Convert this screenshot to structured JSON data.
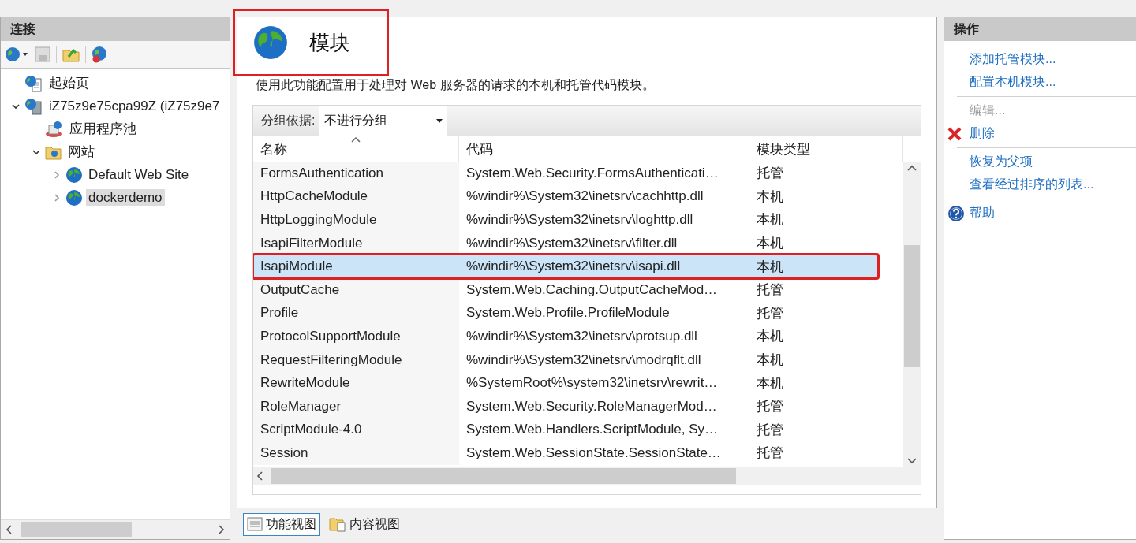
{
  "connections": {
    "title": "连接",
    "tree": [
      {
        "label": "起始页",
        "kind": "start",
        "selected": false
      },
      {
        "label": "iZ75z9e75cpa99Z (iZ75z9e7",
        "kind": "server",
        "expanded": true,
        "selected": false,
        "children": [
          {
            "label": "应用程序池",
            "kind": "pools",
            "selected": false
          },
          {
            "label": "网站",
            "kind": "sites",
            "expanded": true,
            "selected": false,
            "children": [
              {
                "label": "Default Web Site",
                "kind": "site",
                "expanded": false,
                "selected": false
              },
              {
                "label": "dockerdemo",
                "kind": "site",
                "expanded": false,
                "selected": true
              }
            ]
          }
        ]
      }
    ]
  },
  "main": {
    "title": "模块",
    "title_highlighted": true,
    "description": "使用此功能配置用于处理对 Web 服务器的请求的本机和托管代码模块。",
    "group_by": {
      "label": "分组依据:",
      "value": "不进行分组"
    },
    "columns": [
      {
        "label": "名称",
        "sorted": true
      },
      {
        "label": "代码",
        "sorted": false
      },
      {
        "label": "模块类型",
        "sorted": false
      }
    ],
    "rows": [
      {
        "cells": [
          "FormsAuthentication",
          "System.Web.Security.FormsAuthenticati…",
          "托管"
        ],
        "selected": false,
        "highlighted": false
      },
      {
        "cells": [
          "HttpCacheModule",
          "%windir%\\System32\\inetsrv\\cachhttp.dll",
          "本机"
        ],
        "selected": false,
        "highlighted": false
      },
      {
        "cells": [
          "HttpLoggingModule",
          "%windir%\\System32\\inetsrv\\loghttp.dll",
          "本机"
        ],
        "selected": false,
        "highlighted": false
      },
      {
        "cells": [
          "IsapiFilterModule",
          "%windir%\\System32\\inetsrv\\filter.dll",
          "本机"
        ],
        "selected": false,
        "highlighted": false
      },
      {
        "cells": [
          "IsapiModule",
          "%windir%\\System32\\inetsrv\\isapi.dll",
          "本机"
        ],
        "selected": true,
        "highlighted": true
      },
      {
        "cells": [
          "OutputCache",
          "System.Web.Caching.OutputCacheMod…",
          "托管"
        ],
        "selected": false,
        "highlighted": false
      },
      {
        "cells": [
          "Profile",
          "System.Web.Profile.ProfileModule",
          "托管"
        ],
        "selected": false,
        "highlighted": false
      },
      {
        "cells": [
          "ProtocolSupportModule",
          "%windir%\\System32\\inetsrv\\protsup.dll",
          "本机"
        ],
        "selected": false,
        "highlighted": false
      },
      {
        "cells": [
          "RequestFilteringModule",
          "%windir%\\System32\\inetsrv\\modrqflt.dll",
          "本机"
        ],
        "selected": false,
        "highlighted": false
      },
      {
        "cells": [
          "RewriteModule",
          "%SystemRoot%\\system32\\inetsrv\\rewrit…",
          "本机"
        ],
        "selected": false,
        "highlighted": false
      },
      {
        "cells": [
          "RoleManager",
          "System.Web.Security.RoleManagerMod…",
          "托管"
        ],
        "selected": false,
        "highlighted": false
      },
      {
        "cells": [
          "ScriptModule-4.0",
          "System.Web.Handlers.ScriptModule, Sy…",
          "托管"
        ],
        "selected": false,
        "highlighted": false
      },
      {
        "cells": [
          "Session",
          "System.Web.SessionState.SessionState…",
          "托管"
        ],
        "selected": false,
        "highlighted": false
      }
    ],
    "view_tabs": [
      {
        "label": "功能视图",
        "kind": "features",
        "selected": true
      },
      {
        "label": "内容视图",
        "kind": "content",
        "selected": false
      }
    ]
  },
  "actions": {
    "title": "操作",
    "groups": [
      [
        {
          "label": "添加托管模块...",
          "disabled": false
        },
        {
          "label": "配置本机模块...",
          "disabled": false
        }
      ],
      [
        {
          "label": "编辑...",
          "disabled": true
        },
        {
          "label": "删除",
          "disabled": false,
          "kind": "delete"
        }
      ],
      [
        {
          "label": "恢复为父项",
          "disabled": false
        },
        {
          "label": "查看经过排序的列表...",
          "disabled": false
        }
      ],
      [
        {
          "label": "帮助",
          "disabled": false,
          "kind": "help"
        }
      ]
    ]
  }
}
